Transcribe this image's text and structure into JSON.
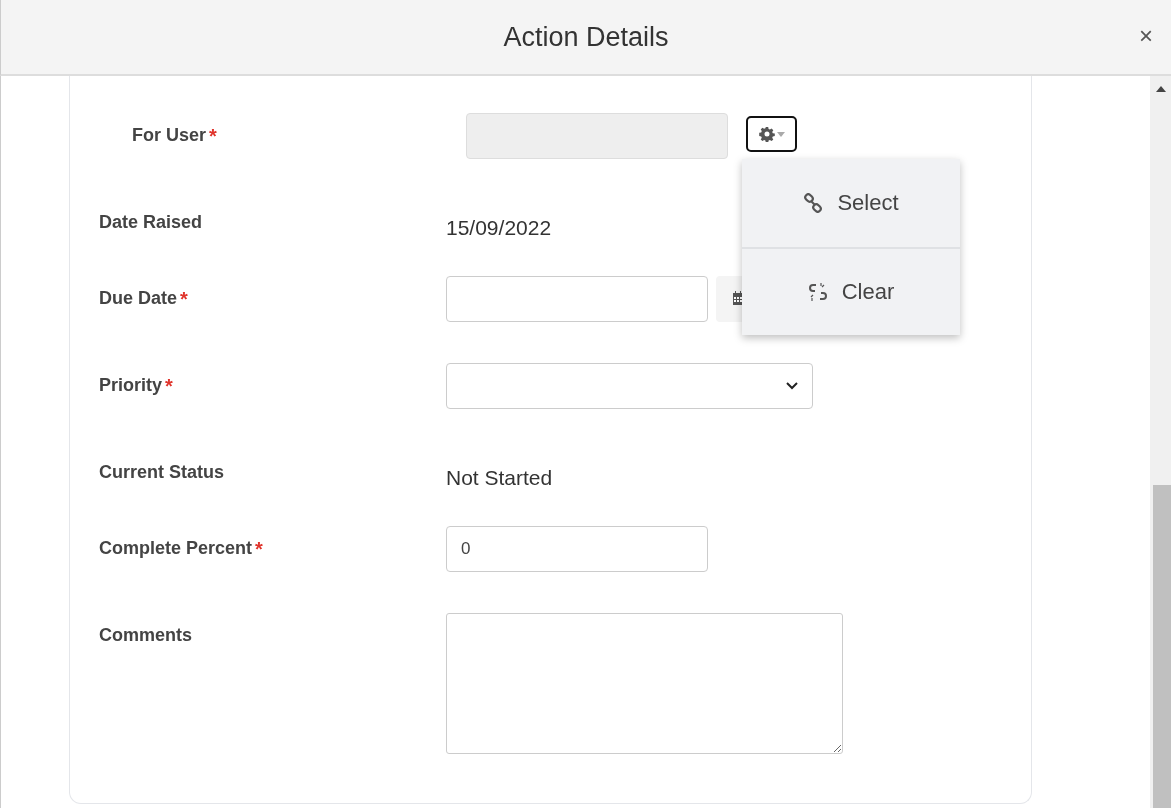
{
  "dialog": {
    "title": "Action Details",
    "close": "×"
  },
  "fields": [
    {
      "label": "For User",
      "required_mark": "*",
      "kind": "lookup",
      "disabled": true,
      "menu": {
        "open": true,
        "items": [
          {
            "label": "Select",
            "kind": "link"
          },
          {
            "label": "Clear",
            "kind": "unlink"
          }
        ]
      }
    },
    {
      "label": "Date Raised",
      "kind": "text",
      "value": "15/09/2022"
    },
    {
      "label": "Due Date",
      "required_mark": "*",
      "kind": "date"
    },
    {
      "label": "Priority",
      "required_mark": "*",
      "kind": "select"
    },
    {
      "label": "Current Status",
      "kind": "text",
      "value": "Not Started"
    },
    {
      "label": "Complete Percent",
      "required_mark": "*",
      "kind": "input",
      "value": "0"
    },
    {
      "label": "Comments",
      "kind": "textarea"
    }
  ]
}
